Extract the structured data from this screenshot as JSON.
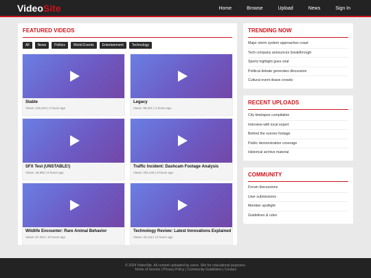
{
  "header": {
    "logo_part1": "Video",
    "logo_part2": "Site",
    "nav": [
      "Home",
      "Browse",
      "Upload",
      "News",
      "Sign In"
    ]
  },
  "featured": {
    "title": "FEATURED VIDEOS",
    "filters": [
      "All",
      "News",
      "Politics",
      "World Events",
      "Entertainment",
      "Technology"
    ],
    "videos": [
      {
        "title": "Stable",
        "meta": "Views: 125,423 | 2 hours ago"
      },
      {
        "title": "Legacy",
        "meta": "Views: 98,201 | 4 hours ago"
      },
      {
        "title": "SFX Test (UNSTABLE!)",
        "meta": "Views: 45,892 | 6 hours ago"
      },
      {
        "title": "Traffic Incident: Dashcam Footage Analysis",
        "meta": "Views: 201,445 | 8 hours ago"
      },
      {
        "title": "Wildlife Encounter: Rare Animal Behavior",
        "meta": "Views: 67,334 | 10 hours ago"
      },
      {
        "title": "Technology Review: Latest Innovations Explained",
        "meta": "Views: 34,112 | 12 hours ago"
      }
    ]
  },
  "trending": {
    "title": "TRENDING NOW",
    "items": [
      "Major storm system approaches coast",
      "Tech company announces breakthrough",
      "Sports highlight goes viral",
      "Political debate generates discussion",
      "Cultural event draws crowds"
    ]
  },
  "recent": {
    "title": "RECENT UPLOADS",
    "items": [
      "City timelapse compilation",
      "Interview with local expert",
      "Behind the scenes footage",
      "Public demonstration coverage",
      "Historical archive material"
    ]
  },
  "community": {
    "title": "COMMUNITY",
    "items": [
      "Forum discussions",
      "User submissions",
      "Member spotlight",
      "Guidelines & rules"
    ]
  },
  "footer": {
    "line1": "© 2024 VideoSite. All content uploaded by users. Site for educational purposes.",
    "line2": "Terms of Service | Privacy Policy | Community Guidelines | Contact"
  },
  "colors": {
    "accent": "#d0121c",
    "header_bg": "#232323",
    "page_bg": "#e9e9e9"
  }
}
